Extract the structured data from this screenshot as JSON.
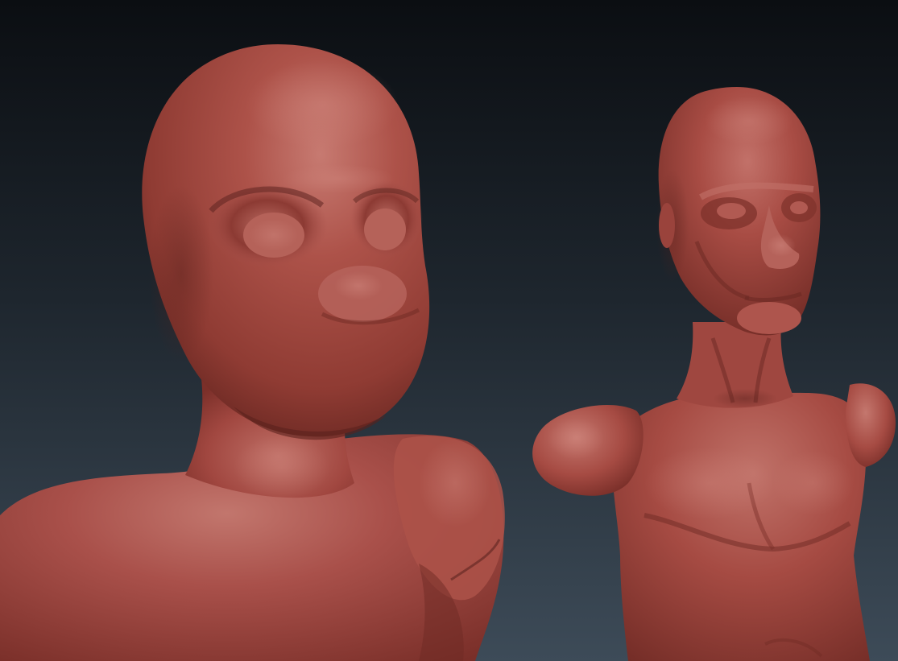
{
  "viewport": {
    "background_top": "#0b0e12",
    "background_bottom": "#3d4b58"
  },
  "scene": {
    "material_color": "#a4473e",
    "material_shadow": "#5e2520",
    "material_highlight": "#c97a72",
    "models": [
      {
        "name": "stylized-figure-bust"
      },
      {
        "name": "male-figure-bust"
      }
    ]
  }
}
